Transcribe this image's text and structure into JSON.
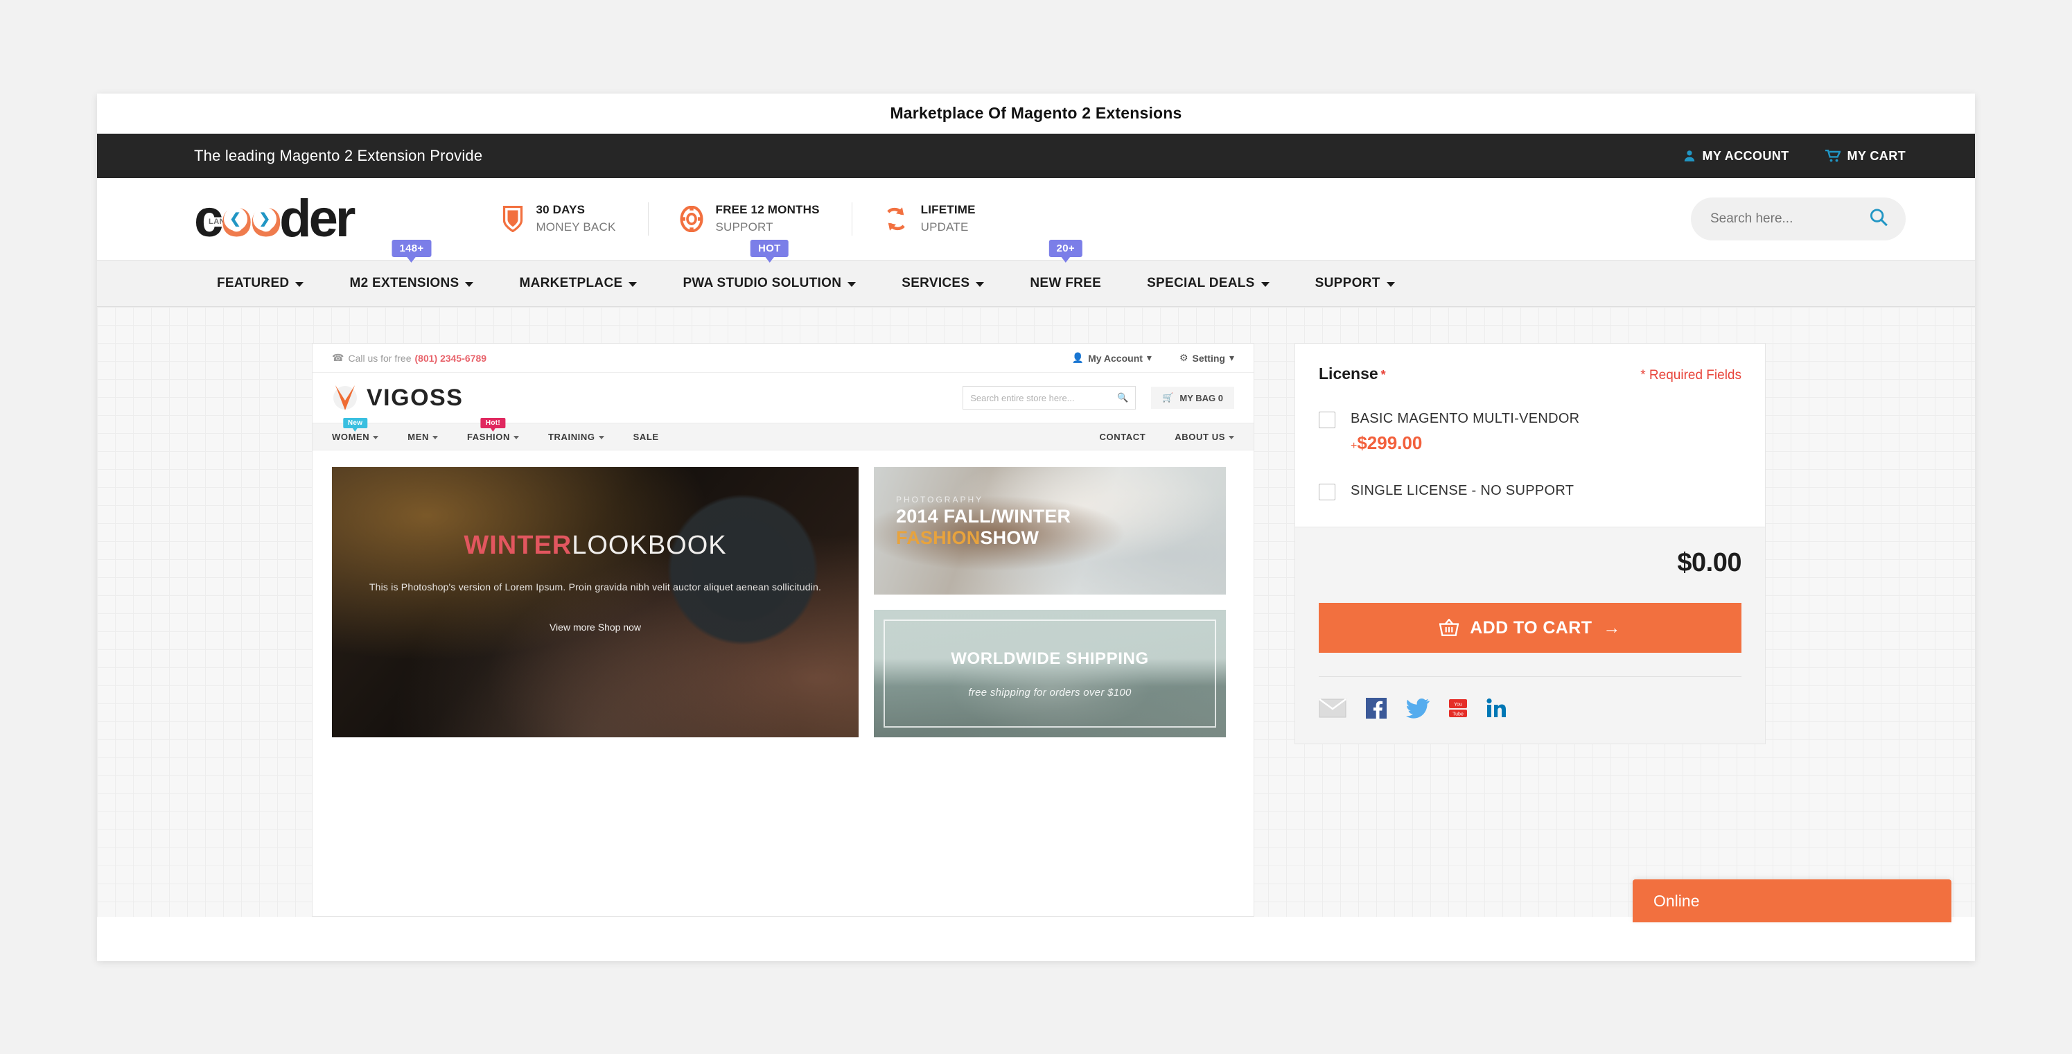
{
  "browser": {
    "title": "Marketplace Of Magento 2 Extensions"
  },
  "topbar": {
    "tagline": "The leading Magento 2 Extension Provide",
    "my_account": "MY ACCOUNT",
    "my_cart": "MY CART"
  },
  "logo": {
    "prefix": "LAND OF",
    "c": "c",
    "o1": "o",
    "o2": "o",
    "suffix": "der",
    "chevron_left": "❮",
    "chevron_right": "❯"
  },
  "features": [
    {
      "icon": "shield-icon",
      "line1": "30 DAYS",
      "line2": "MONEY BACK"
    },
    {
      "icon": "lifering-icon",
      "line1": "FREE 12 MONTHS",
      "line2": "SUPPORT"
    },
    {
      "icon": "refresh-icon",
      "line1": "LIFETIME",
      "line2": "UPDATE"
    }
  ],
  "search": {
    "placeholder": "Search here...",
    "value": ""
  },
  "nav": [
    {
      "label": "FEATURED",
      "caret": true,
      "badge": null
    },
    {
      "label": "M2 EXTENSIONS",
      "caret": true,
      "badge": "148+"
    },
    {
      "label": "MARKETPLACE",
      "caret": true,
      "badge": null
    },
    {
      "label": "PWA STUDIO SOLUTION",
      "caret": true,
      "badge": "HOT"
    },
    {
      "label": "SERVICES",
      "caret": true,
      "badge": null
    },
    {
      "label": "NEW FREE",
      "caret": false,
      "badge": "20+"
    },
    {
      "label": "SPECIAL DEALS",
      "caret": true,
      "badge": null
    },
    {
      "label": "SUPPORT",
      "caret": true,
      "badge": null
    }
  ],
  "preview": {
    "call_label": "Call us for free",
    "phone": "(801) 2345-6789",
    "my_account": "My Account",
    "setting": "Setting",
    "brand": "VIGOSS",
    "search_placeholder": "Search entire store here...",
    "bag": "MY BAG 0",
    "nav": [
      {
        "label": "WOMEN",
        "caret": true,
        "badge": "New",
        "badge_kind": "new"
      },
      {
        "label": "MEN",
        "caret": true,
        "badge": null,
        "badge_kind": null
      },
      {
        "label": "FASHION",
        "caret": true,
        "badge": "Hot!",
        "badge_kind": "hot"
      },
      {
        "label": "TRAINING",
        "caret": true,
        "badge": null,
        "badge_kind": null
      },
      {
        "label": "SALE",
        "caret": false,
        "badge": null,
        "badge_kind": null
      }
    ],
    "nav_right": [
      {
        "label": "CONTACT",
        "caret": false
      },
      {
        "label": "ABOUT US",
        "caret": true
      }
    ],
    "hero": {
      "title_strong": "WINTER",
      "title_light": "LOOKBOOK",
      "paragraph": "This is Photoshop's version of Lorem Ipsum. Proin gravida nibh velit auctor aliquet aenean sollicitudin.",
      "cta": "View more Shop now"
    },
    "tile_fashion": {
      "kicker": "PHOTOGRAPHY",
      "line1": "2014 FALL/WINTER",
      "line2_accent": "FASHION",
      "line2_rest": "SHOW"
    },
    "tile_shipping": {
      "title": "WORLDWIDE SHIPPING",
      "subtitle": "free shipping for orders over $100"
    }
  },
  "panel": {
    "license_label": "License",
    "required_star": "*",
    "required_fields": "* Required Fields",
    "options": [
      {
        "name": "BASIC MAGENTO MULTI-VENDOR",
        "price_plus": "+",
        "price": "$299.00",
        "checked": false
      },
      {
        "name": "SINGLE LICENSE - NO SUPPORT",
        "price_plus": "",
        "price": "",
        "checked": false
      }
    ],
    "grand_total": "$0.00",
    "add_to_cart": "ADD TO CART",
    "cart_arrow": "→",
    "social": [
      {
        "name": "email-icon"
      },
      {
        "name": "facebook-icon"
      },
      {
        "name": "twitter-icon"
      },
      {
        "name": "youtube-icon"
      },
      {
        "name": "linkedin-icon"
      }
    ]
  },
  "chat": {
    "status": "Online"
  },
  "colors": {
    "accent_orange": "#f2703f",
    "price_orange": "#f2603c",
    "badge_purple": "#7b7ee8",
    "link_blue": "#2196c4",
    "required_red": "#e8443a"
  }
}
